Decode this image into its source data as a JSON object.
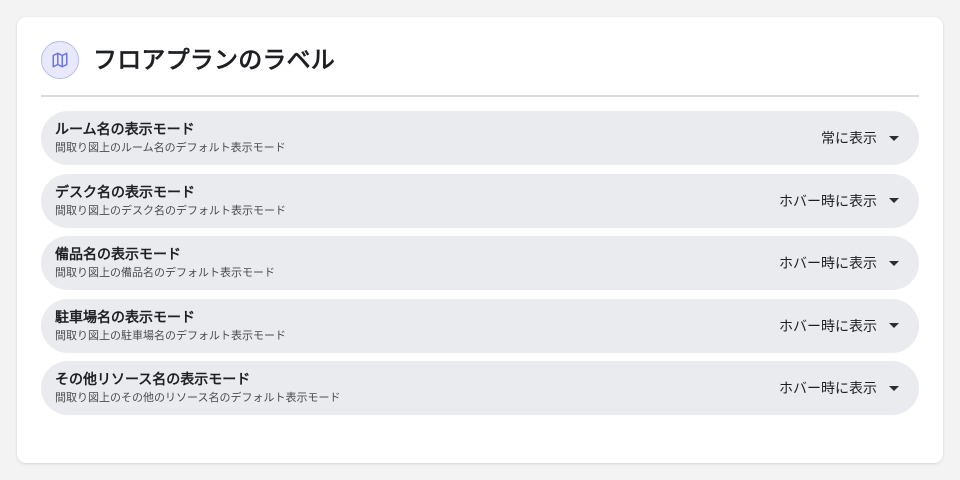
{
  "header": {
    "title": "フロアプランのラベル",
    "icon": "map-icon",
    "accent_color": "#6d73e3"
  },
  "settings": [
    {
      "title": "ルーム名の表示モード",
      "description": "間取り図上のルーム名のデフォルト表示モード",
      "value": "常に表示"
    },
    {
      "title": "デスク名の表示モード",
      "description": "間取り図上のデスク名のデフォルト表示モード",
      "value": "ホバー時に表示"
    },
    {
      "title": "備品名の表示モード",
      "description": "間取り図上の備品名のデフォルト表示モード",
      "value": "ホバー時に表示"
    },
    {
      "title": "駐車場名の表示モード",
      "description": "間取り図上の駐車場名のデフォルト表示モード",
      "value": "ホバー時に表示"
    },
    {
      "title": "その他リソース名の表示モード",
      "description": "間取り図上のその他のリソース名のデフォルト表示モード",
      "value": "ホバー時に表示"
    }
  ]
}
